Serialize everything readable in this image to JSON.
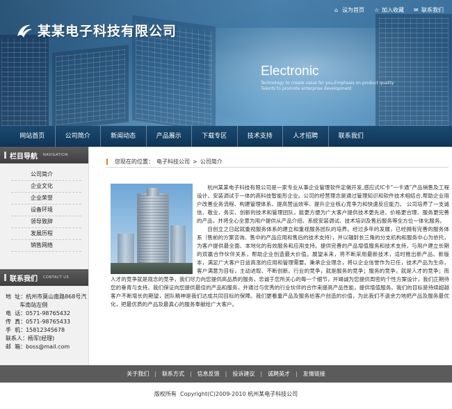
{
  "top_links": [
    {
      "icon": "home-icon",
      "label": "设为首页"
    },
    {
      "icon": "star-icon",
      "label": "加入收藏"
    },
    {
      "icon": "mail-icon",
      "label": "联系我们"
    }
  ],
  "brand": {
    "name": "某某电子科技有限公司",
    "slogan_big": "Electronic",
    "slogan_line1": "Technology to create value for you,Emphasis on product quality",
    "slogan_line2": "Talents to promote enterprise development"
  },
  "nav": [
    "网站首页",
    "公司简介",
    "新闻动态",
    "产品展示",
    "下载专区",
    "技术支持",
    "人才招聘",
    "联系我们"
  ],
  "sidebar": {
    "menu_title": "栏目导航",
    "menu_title_en": "NAVIGATION",
    "menu": [
      "公司简介",
      "企业文化",
      "企业荣誉",
      "设备环境",
      "领导致辞",
      "发展历程",
      "销售网络"
    ],
    "contact_title": "联系我们",
    "contact_title_en": "CONTACT US",
    "contact": [
      "地  址：杭州市莫山南路868号汽",
      "        车南站左侧",
      "电  话：0571-98765432",
      "传  真：0571-98765433",
      "手  机：15812345678",
      "联系人：杨军(经理)",
      "邮  箱：boss@mail.com"
    ]
  },
  "breadcrumb": {
    "prefix": "您现在的位置：",
    "root": "电子科技公司",
    "sep": ">",
    "current": "公司简介"
  },
  "article": {
    "p1": "杭州某某电子科技有限公司是一家专业从事企业管理软件定做开发,感应式IC卡“一卡通”产品销售及工程设计、安装调试于一体的高科技智能形企业。公司的经营理念是通过管理知识和软件技术相结合,帮助企业用户改善业务流程、构建管理体系、提高营运效率、提升企业核心竞争力和快速反应能力。 公司培养了一支诚信、敬业、务实、创新的技术和管理团队，能更方便为广大客户提供技术更先进、价格更合理、服务更完善的产品，并将全心全意为用户提供从产品介绍、系统安装调试、技术培训及售后服务等全方位一体化服务。",
    "p2": "自创立之日起就重视服务体系的建立和重视服务团队的培养。经过多年的发展，已经拥有完善的服务体系（售前的方案咨询、售中的产品应用和售后的技术支持），并以辐射长三角的分支机构和服务中心为依托，为客户提供最全面、本地化的有效服务和应用支持。提供完善的产品增值服务和技术支持，与用户建立长期的双赢合作伙伴关系，帮助企业创造最大价值。展望未来，将不断采用最新技术，适时推出新产品、新版本，满足广大客户日益高涨的应用和管理需要。秉承企业理念，将以企业信誉作为已任，技术产品为生命，客户满意为目标，主动进取、不断创新。行业的竞争，就是服务的竞争；服务的竞争，就是人才的竞争；而人才的竞争就是观念的竞争，我们尽力向您提供高品质的服务，忠诚于您所关心的每一个细节，并竭诚为您提供周密的个性方案设计，我们正期待您的垂青与支持。我们保证向您提供最佳的产品和服务，并通过与优秀的行业伙伴的合作来提高产品性能，提供增值服务。我们的目标是持续超越客户不断增长的期望，团队精神是我们达成共同目标的保障。我们更看重产品及服务给客户创造的价值，为此我们不遗余力地把产品及服务最优化，把最优质的产品及最真心的服务奉献给广大客户。"
  },
  "footer": {
    "links": [
      "关于我们",
      "联系方式",
      "信息反馈",
      "投诉建议",
      "诚聘英才",
      "友情链接"
    ],
    "copyright": "版权所有  Copyright(C)2009-2010 杭州某电子科技公司"
  }
}
